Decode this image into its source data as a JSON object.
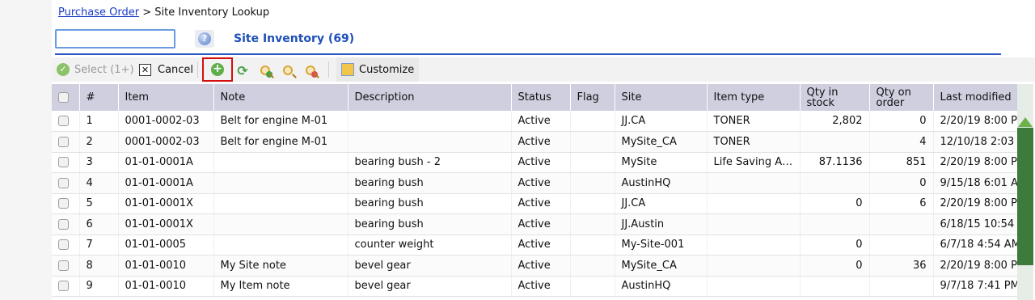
{
  "breadcrumb": {
    "link": "Purchase Order",
    "separator": ">",
    "current": "Site Inventory Lookup"
  },
  "search": {
    "value": "",
    "placeholder": ""
  },
  "panel": {
    "title": "Site Inventory (69)"
  },
  "toolbar": {
    "select_label": "Select (1+)",
    "cancel_label": "Cancel",
    "customize_label": "Customize",
    "icons": [
      "check-circle-icon",
      "close-box-icon",
      "add-circle-icon",
      "refresh-icon",
      "zoom-in-icon",
      "zoom-icon",
      "zoom-out-icon",
      "customize-icon"
    ]
  },
  "table": {
    "headers": [
      "#",
      "Item",
      "Note",
      "Description",
      "Status",
      "Flag",
      "Site",
      "Item type",
      "Qty in stock",
      "Qty on order",
      "Last modified"
    ],
    "rows": [
      {
        "num": "1",
        "item": "0001-0002-03",
        "note": "Belt for engine M-01",
        "desc": "",
        "status": "Active",
        "flag": "",
        "site": "JJ.CA",
        "type": "TONER",
        "qty_stock": "2,802",
        "qty_order": "0",
        "modified": "2/20/19 8:00 P"
      },
      {
        "num": "2",
        "item": "0001-0002-03",
        "note": "Belt for engine M-01",
        "desc": "",
        "status": "Active",
        "flag": "",
        "site": "MySite_CA",
        "type": "TONER",
        "qty_stock": "",
        "qty_order": "4",
        "modified": "12/10/18 2:03"
      },
      {
        "num": "3",
        "item": "01-01-0001A",
        "note": "",
        "desc": "bearing bush - 2",
        "status": "Active",
        "flag": "",
        "site": "MySite",
        "type": "Life Saving Applia…",
        "qty_stock": "87.1136",
        "qty_order": "851",
        "modified": "2/20/19 8:00 P"
      },
      {
        "num": "4",
        "item": "01-01-0001A",
        "note": "",
        "desc": "bearing bush",
        "status": "Active",
        "flag": "",
        "site": "AustinHQ",
        "type": "",
        "qty_stock": "",
        "qty_order": "0",
        "modified": "9/15/18 6:01 A"
      },
      {
        "num": "5",
        "item": "01-01-0001X",
        "note": "",
        "desc": "bearing bush",
        "status": "Active",
        "flag": "",
        "site": "JJ.CA",
        "type": "",
        "qty_stock": "0",
        "qty_order": "6",
        "modified": "2/20/19 8:00 P"
      },
      {
        "num": "6",
        "item": "01-01-0001X",
        "note": "",
        "desc": "bearing bush",
        "status": "Active",
        "flag": "",
        "site": "JJ.Austin",
        "type": "",
        "qty_stock": "",
        "qty_order": "",
        "modified": "6/18/15 10:54"
      },
      {
        "num": "7",
        "item": "01-01-0005",
        "note": "",
        "desc": "counter weight",
        "status": "Active",
        "flag": "",
        "site": "My-Site-001",
        "type": "",
        "qty_stock": "0",
        "qty_order": "",
        "modified": "6/7/18 4:54 AM"
      },
      {
        "num": "8",
        "item": "01-01-0010",
        "note": "My Site note",
        "desc": "bevel gear",
        "status": "Active",
        "flag": "",
        "site": "MySite_CA",
        "type": "",
        "qty_stock": "0",
        "qty_order": "36",
        "modified": "2/20/19 8:00 P"
      },
      {
        "num": "9",
        "item": "01-01-0010",
        "note": "My Item note",
        "desc": "bevel gear",
        "status": "Active",
        "flag": "",
        "site": "AustinHQ",
        "type": "",
        "qty_stock": "",
        "qty_order": "",
        "modified": "9/7/18 7:41 PM"
      }
    ]
  },
  "colors": {
    "accent": "#1f4fb8",
    "header_bg": "#cfcfe0",
    "highlight_border": "#d40d0d",
    "scroll_thumb": "#3d7a3b"
  }
}
